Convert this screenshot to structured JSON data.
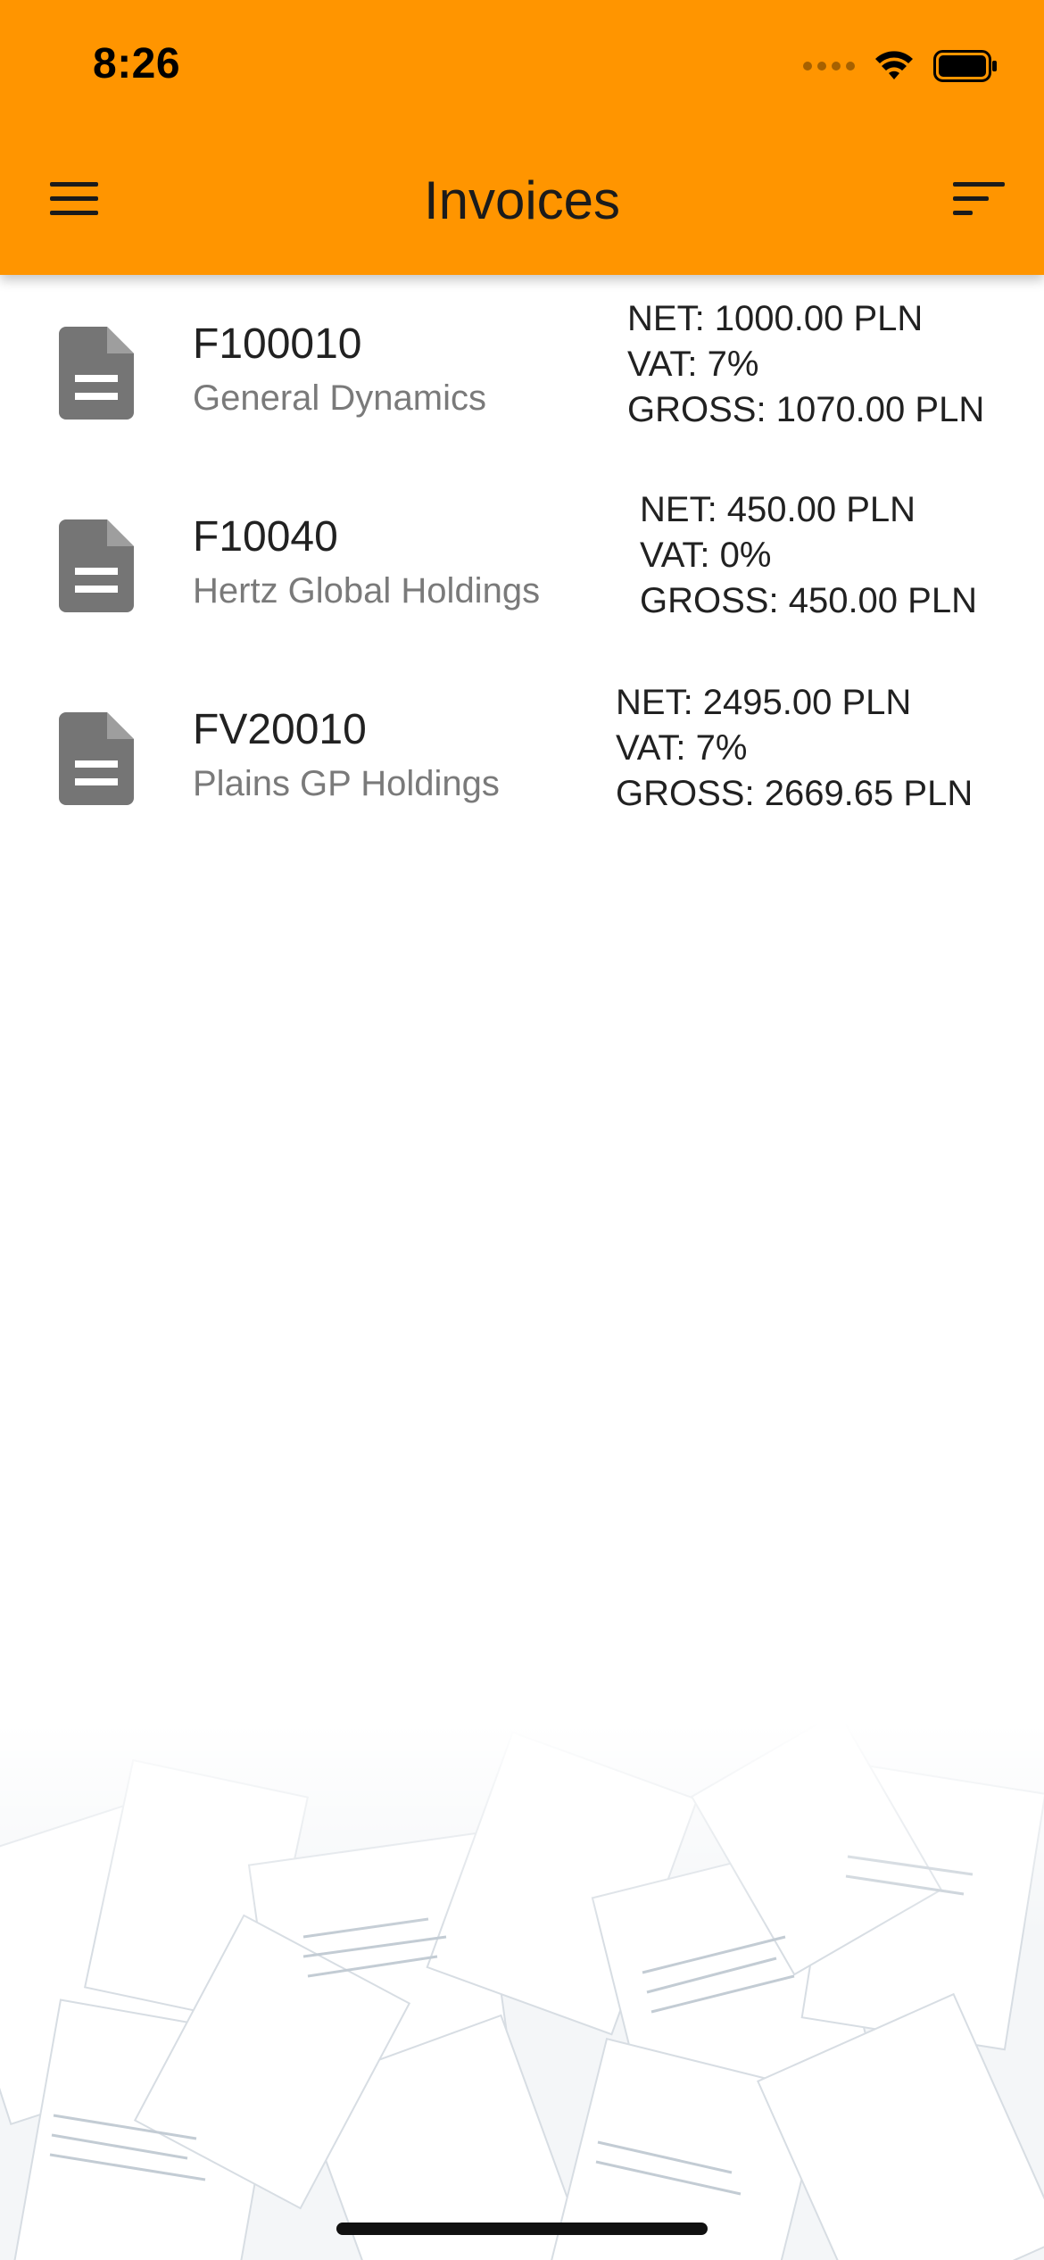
{
  "status_bar": {
    "time": "8:26"
  },
  "header": {
    "title": "Invoices",
    "menu_icon": "hamburger-menu-icon",
    "sort_icon": "sort-icon",
    "background_color": "#FF9500"
  },
  "invoices": [
    {
      "number": "F100010",
      "client": "General Dynamics",
      "net": "NET: 1000.00 PLN",
      "vat": "VAT: 7%",
      "gross": "GROSS: 1070.00 PLN",
      "icon": "document-icon"
    },
    {
      "number": "F10040",
      "client": "Hertz Global Holdings",
      "net": "NET: 450.00 PLN",
      "vat": "VAT: 0%",
      "gross": "GROSS: 450.00 PLN",
      "icon": "document-icon"
    },
    {
      "number": "FV20010",
      "client": "Plains GP Holdings",
      "net": "NET: 2495.00 PLN",
      "vat": "VAT: 7%",
      "gross": "GROSS: 2669.65 PLN",
      "icon": "document-icon"
    }
  ]
}
